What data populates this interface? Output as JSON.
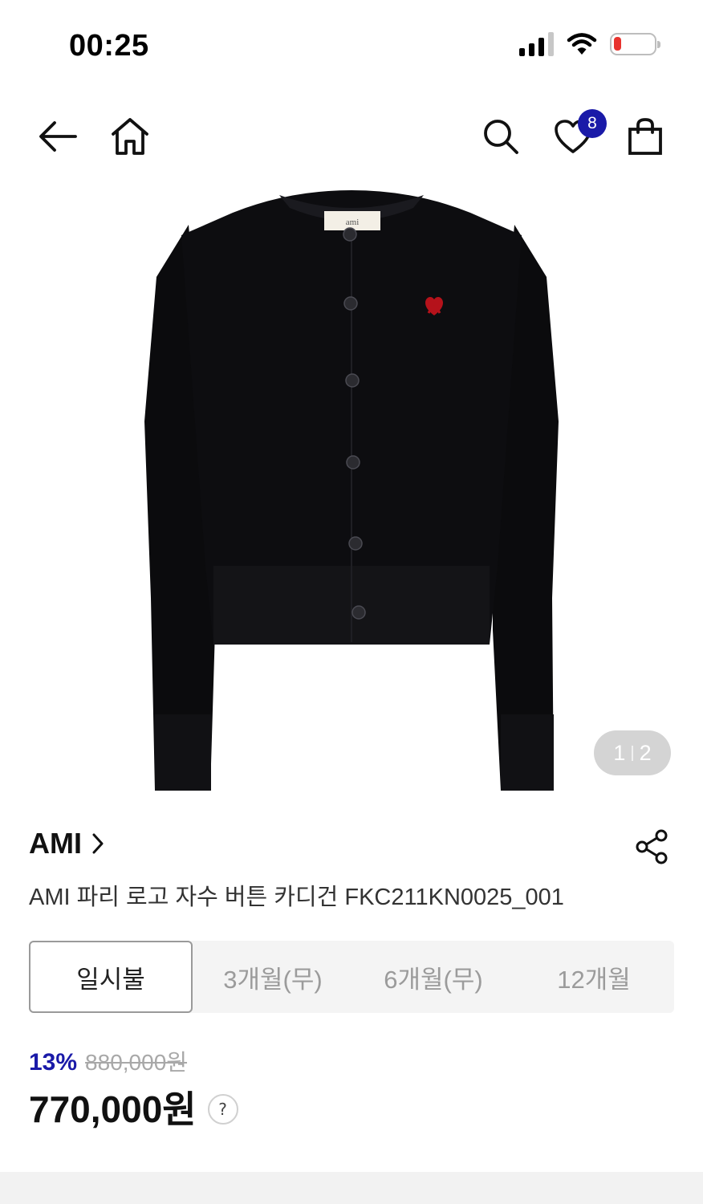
{
  "status_bar": {
    "time": "00:25",
    "battery_color": "#e8332e"
  },
  "nav": {
    "back_icon": "back-arrow-icon",
    "home_icon": "home-icon",
    "search_icon": "search-icon",
    "wishlist_icon": "heart-icon",
    "wishlist_count": "8",
    "cart_icon": "shopping-bag-icon"
  },
  "gallery": {
    "current": "1",
    "total": "2",
    "garment_label": "ami"
  },
  "product": {
    "brand": "AMI",
    "title": "AMI 파리 로고 자수 버튼 카디건 FKC211KN0025_001"
  },
  "installment_tabs": [
    {
      "label": "일시불",
      "active": true
    },
    {
      "label": "3개월(무)",
      "active": false
    },
    {
      "label": "6개월(무)",
      "active": false
    },
    {
      "label": "12개월",
      "active": false
    }
  ],
  "price": {
    "discount_rate": "13%",
    "original_price": "880,000원",
    "final_price": "770,000원",
    "help_label": "?"
  },
  "colors": {
    "accent": "#1a1aa8",
    "text": "#111111",
    "muted": "#a8a8a8"
  }
}
